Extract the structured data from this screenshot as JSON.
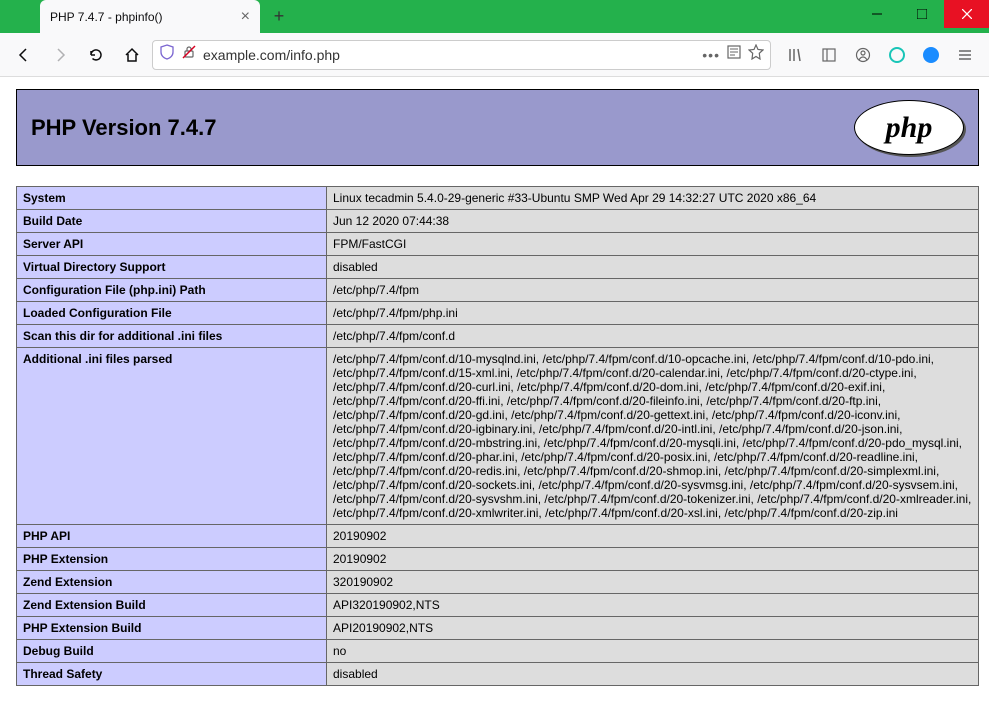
{
  "window": {
    "tab_title": "PHP 7.4.7 - phpinfo()"
  },
  "addressbar": {
    "url": "example.com/info.php"
  },
  "php": {
    "header_title": "PHP Version 7.4.7",
    "logo_text": "php"
  },
  "rows": [
    {
      "k": "System",
      "v": "Linux tecadmin 5.4.0-29-generic #33-Ubuntu SMP Wed Apr 29 14:32:27 UTC 2020 x86_64"
    },
    {
      "k": "Build Date",
      "v": "Jun 12 2020 07:44:38"
    },
    {
      "k": "Server API",
      "v": "FPM/FastCGI"
    },
    {
      "k": "Virtual Directory Support",
      "v": "disabled"
    },
    {
      "k": "Configuration File (php.ini) Path",
      "v": "/etc/php/7.4/fpm"
    },
    {
      "k": "Loaded Configuration File",
      "v": "/etc/php/7.4/fpm/php.ini"
    },
    {
      "k": "Scan this dir for additional .ini files",
      "v": "/etc/php/7.4/fpm/conf.d"
    },
    {
      "k": "Additional .ini files parsed",
      "v": "/etc/php/7.4/fpm/conf.d/10-mysqlnd.ini, /etc/php/7.4/fpm/conf.d/10-opcache.ini, /etc/php/7.4/fpm/conf.d/10-pdo.ini, /etc/php/7.4/fpm/conf.d/15-xml.ini, /etc/php/7.4/fpm/conf.d/20-calendar.ini, /etc/php/7.4/fpm/conf.d/20-ctype.ini, /etc/php/7.4/fpm/conf.d/20-curl.ini, /etc/php/7.4/fpm/conf.d/20-dom.ini, /etc/php/7.4/fpm/conf.d/20-exif.ini, /etc/php/7.4/fpm/conf.d/20-ffi.ini, /etc/php/7.4/fpm/conf.d/20-fileinfo.ini, /etc/php/7.4/fpm/conf.d/20-ftp.ini, /etc/php/7.4/fpm/conf.d/20-gd.ini, /etc/php/7.4/fpm/conf.d/20-gettext.ini, /etc/php/7.4/fpm/conf.d/20-iconv.ini, /etc/php/7.4/fpm/conf.d/20-igbinary.ini, /etc/php/7.4/fpm/conf.d/20-intl.ini, /etc/php/7.4/fpm/conf.d/20-json.ini, /etc/php/7.4/fpm/conf.d/20-mbstring.ini, /etc/php/7.4/fpm/conf.d/20-mysqli.ini, /etc/php/7.4/fpm/conf.d/20-pdo_mysql.ini, /etc/php/7.4/fpm/conf.d/20-phar.ini, /etc/php/7.4/fpm/conf.d/20-posix.ini, /etc/php/7.4/fpm/conf.d/20-readline.ini, /etc/php/7.4/fpm/conf.d/20-redis.ini, /etc/php/7.4/fpm/conf.d/20-shmop.ini, /etc/php/7.4/fpm/conf.d/20-simplexml.ini, /etc/php/7.4/fpm/conf.d/20-sockets.ini, /etc/php/7.4/fpm/conf.d/20-sysvmsg.ini, /etc/php/7.4/fpm/conf.d/20-sysvsem.ini, /etc/php/7.4/fpm/conf.d/20-sysvshm.ini, /etc/php/7.4/fpm/conf.d/20-tokenizer.ini, /etc/php/7.4/fpm/conf.d/20-xmlreader.ini, /etc/php/7.4/fpm/conf.d/20-xmlwriter.ini, /etc/php/7.4/fpm/conf.d/20-xsl.ini, /etc/php/7.4/fpm/conf.d/20-zip.ini"
    },
    {
      "k": "PHP API",
      "v": "20190902"
    },
    {
      "k": "PHP Extension",
      "v": "20190902"
    },
    {
      "k": "Zend Extension",
      "v": "320190902"
    },
    {
      "k": "Zend Extension Build",
      "v": "API320190902,NTS"
    },
    {
      "k": "PHP Extension Build",
      "v": "API20190902,NTS"
    },
    {
      "k": "Debug Build",
      "v": "no"
    },
    {
      "k": "Thread Safety",
      "v": "disabled"
    }
  ]
}
